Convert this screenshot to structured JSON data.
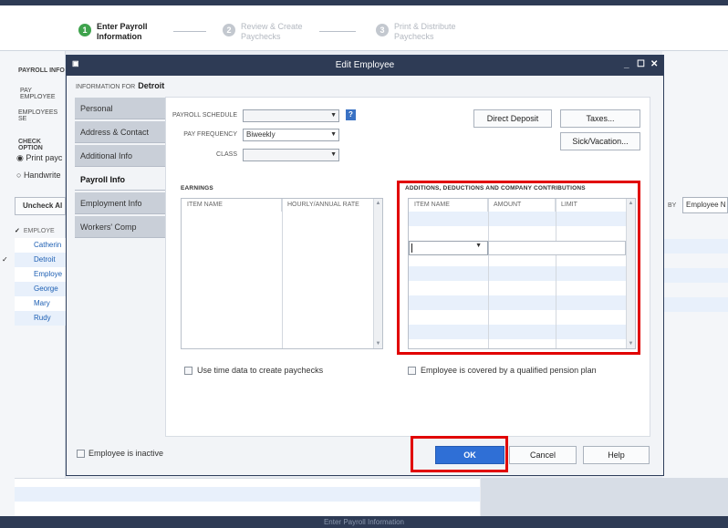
{
  "wizard": {
    "steps": [
      {
        "num": "1",
        "label": "Enter Payroll Information"
      },
      {
        "num": "2",
        "label": "Review & Create Paychecks"
      },
      {
        "num": "3",
        "label": "Print & Distribute Paychecks"
      }
    ]
  },
  "background": {
    "payroll_info_label": "PAYROLL INFO",
    "pay_employees_label": "PAY EMPLOYEE",
    "employees_label": "EMPLOYEES SE",
    "check_options_label": "CHECK OPTION",
    "print_label": "Print payc",
    "handwrite_label": "Handwrite",
    "uncheck_all": "Uncheck Al",
    "employee_col": "EMPLOYE",
    "employees": [
      "Catherin",
      "Detroit",
      "Employe",
      "George",
      "Mary",
      "Rudy"
    ],
    "sort_by_label": "BY",
    "sort_by_value": "Employee N",
    "footer_text": "Enter Payroll Information"
  },
  "dialog": {
    "title": "Edit Employee",
    "info_for_label": "INFORMATION FOR",
    "info_for_value": "Detroit",
    "nav": [
      "Personal",
      "Address & Contact",
      "Additional Info",
      "Payroll Info",
      "Employment Info",
      "Workers' Comp"
    ],
    "active_nav": "Payroll Info",
    "payroll_schedule_label": "PAYROLL SCHEDULE",
    "payroll_schedule_value": "",
    "help_icon_label": "?",
    "pay_frequency_label": "PAY FREQUENCY",
    "pay_frequency_value": "Biweekly",
    "class_label": "CLASS",
    "class_value": "",
    "direct_deposit": "Direct Deposit",
    "taxes": "Taxes...",
    "sick_vacation": "Sick/Vacation...",
    "earnings_title": "EARNINGS",
    "earnings_cols": [
      "ITEM NAME",
      "HOURLY/ANNUAL RATE"
    ],
    "additions_title": "ADDITIONS, DEDUCTIONS AND COMPANY CONTRIBUTIONS",
    "additions_cols": [
      "ITEM NAME",
      "AMOUNT",
      "LIMIT"
    ],
    "use_time_data": "Use time data to create paychecks",
    "pension_plan": "Employee is covered by a qualified pension plan",
    "inactive": "Employee is inactive",
    "ok": "OK",
    "cancel": "Cancel",
    "help": "Help"
  },
  "colors": {
    "titlebar": "#2e3b55",
    "highlight": "#e10000",
    "ok_button": "#2f6fd6",
    "step_active": "#3fa34d",
    "step_inactive": "#c3c8cf"
  }
}
